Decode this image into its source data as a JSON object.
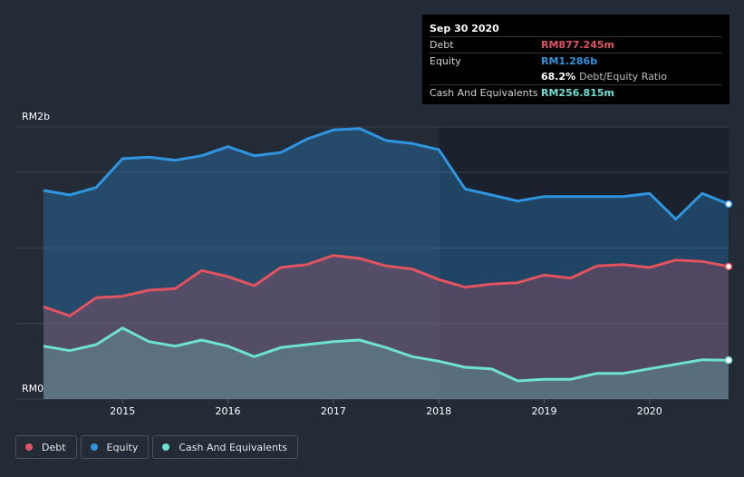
{
  "tooltip": {
    "date": "Sep 30 2020",
    "rows": [
      {
        "label": "Debt",
        "value": "RM877.245m",
        "color": "#e0535f",
        "extra": ""
      },
      {
        "label": "Equity",
        "value": "RM1.286b",
        "color": "#2f95e0",
        "extra": ""
      },
      {
        "label": "",
        "value": "68.2%",
        "color": "#ffffff",
        "extra": "Debt/Equity Ratio"
      },
      {
        "label": "Cash And Equivalents",
        "value": "RM256.815m",
        "color": "#6ee0d4",
        "extra": ""
      }
    ]
  },
  "legend": [
    {
      "label": "Debt",
      "color": "#e0535f"
    },
    {
      "label": "Equity",
      "color": "#2f95e0"
    },
    {
      "label": "Cash And Equivalents",
      "color": "#6ee0d4"
    }
  ],
  "chart_data": {
    "type": "area",
    "y_unit": "RM",
    "ylim": [
      0,
      1.8
    ],
    "y_axis_labels": [
      "RM2b",
      "RM0"
    ],
    "x_tick_labels": [
      "2015",
      "2016",
      "2017",
      "2018",
      "2019",
      "2020"
    ],
    "xlim": [
      2014.25,
      2020.75
    ],
    "series": [
      {
        "name": "Equity",
        "color": "#2f95e0",
        "points": [
          [
            2014.25,
            1.38
          ],
          [
            2014.5,
            1.35
          ],
          [
            2014.75,
            1.4
          ],
          [
            2015,
            1.59
          ],
          [
            2015.25,
            1.6
          ],
          [
            2015.5,
            1.58
          ],
          [
            2015.75,
            1.61
          ],
          [
            2016,
            1.67
          ],
          [
            2016.25,
            1.61
          ],
          [
            2016.5,
            1.63
          ],
          [
            2016.75,
            1.72
          ],
          [
            2017,
            1.78
          ],
          [
            2017.25,
            1.79
          ],
          [
            2017.5,
            1.71
          ],
          [
            2017.75,
            1.69
          ],
          [
            2018,
            1.65
          ],
          [
            2018.25,
            1.39
          ],
          [
            2018.5,
            1.35
          ],
          [
            2018.75,
            1.31
          ],
          [
            2019,
            1.34
          ],
          [
            2019.25,
            1.34
          ],
          [
            2019.5,
            1.34
          ],
          [
            2019.75,
            1.34
          ],
          [
            2020,
            1.36
          ],
          [
            2020.25,
            1.19
          ],
          [
            2020.5,
            1.36
          ],
          [
            2020.75,
            1.29
          ]
        ]
      },
      {
        "name": "Debt",
        "color": "#e0535f",
        "points": [
          [
            2014.25,
            0.61
          ],
          [
            2014.5,
            0.55
          ],
          [
            2014.75,
            0.67
          ],
          [
            2015,
            0.68
          ],
          [
            2015.25,
            0.72
          ],
          [
            2015.5,
            0.73
          ],
          [
            2015.75,
            0.85
          ],
          [
            2016,
            0.81
          ],
          [
            2016.25,
            0.75
          ],
          [
            2016.5,
            0.87
          ],
          [
            2016.75,
            0.89
          ],
          [
            2017,
            0.95
          ],
          [
            2017.25,
            0.93
          ],
          [
            2017.5,
            0.88
          ],
          [
            2017.75,
            0.86
          ],
          [
            2018,
            0.79
          ],
          [
            2018.25,
            0.74
          ],
          [
            2018.5,
            0.76
          ],
          [
            2018.75,
            0.77
          ],
          [
            2019,
            0.82
          ],
          [
            2019.25,
            0.8
          ],
          [
            2019.5,
            0.88
          ],
          [
            2019.75,
            0.89
          ],
          [
            2020,
            0.87
          ],
          [
            2020.25,
            0.92
          ],
          [
            2020.5,
            0.91
          ],
          [
            2020.75,
            0.877
          ]
        ]
      },
      {
        "name": "Cash And Equivalents",
        "color": "#6ee0d4",
        "points": [
          [
            2014.25,
            0.35
          ],
          [
            2014.5,
            0.32
          ],
          [
            2014.75,
            0.36
          ],
          [
            2015,
            0.47
          ],
          [
            2015.25,
            0.38
          ],
          [
            2015.5,
            0.35
          ],
          [
            2015.75,
            0.39
          ],
          [
            2016,
            0.35
          ],
          [
            2016.25,
            0.28
          ],
          [
            2016.5,
            0.34
          ],
          [
            2016.75,
            0.36
          ],
          [
            2017,
            0.38
          ],
          [
            2017.25,
            0.39
          ],
          [
            2017.5,
            0.34
          ],
          [
            2017.75,
            0.28
          ],
          [
            2018,
            0.25
          ],
          [
            2018.25,
            0.21
          ],
          [
            2018.5,
            0.2
          ],
          [
            2018.75,
            0.12
          ],
          [
            2019,
            0.13
          ],
          [
            2019.25,
            0.13
          ],
          [
            2019.5,
            0.17
          ],
          [
            2019.75,
            0.17
          ],
          [
            2020,
            0.2
          ],
          [
            2020.25,
            0.23
          ],
          [
            2020.5,
            0.26
          ],
          [
            2020.75,
            0.257
          ]
        ]
      }
    ],
    "highlight_date": "Sep 30 2020",
    "grid": true,
    "legend_position": "bottom-left"
  }
}
